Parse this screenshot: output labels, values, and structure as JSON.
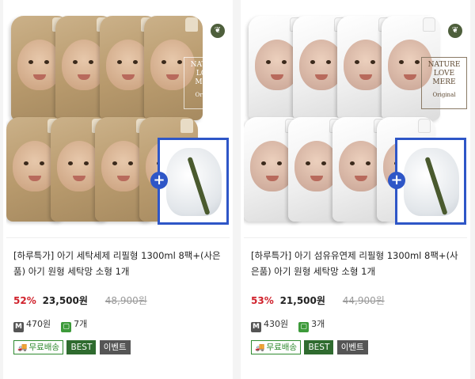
{
  "products": [
    {
      "variant": "kraft",
      "brand_lines": [
        "NATURE",
        "LOVE",
        "MERE"
      ],
      "brand_sub": "Original",
      "title": "[하루특가] 아기 세탁세제 리필형 1300ml 8팩+(사은품) 아기 원형 세탁망 소형 1개",
      "discount_rate": "52%",
      "sale_price": "23,500원",
      "original_price": "48,900원",
      "points_badge": "M",
      "points": "470원",
      "reviews_badge": "▢",
      "reviews": "7개",
      "tags": {
        "shipping": "무료배송",
        "best": "BEST",
        "event": "이벤트"
      }
    },
    {
      "variant": "white",
      "brand_lines": [
        "NATURE",
        "LOVE",
        "MERE"
      ],
      "brand_sub": "Original",
      "title": "[하루특가] 아기 섬유유연제 리필형 1300ml 8팩+(사은품) 아기 원형 세탁망 소형 1개",
      "discount_rate": "53%",
      "sale_price": "21,500원",
      "original_price": "44,900원",
      "points_badge": "M",
      "points": "430원",
      "reviews_badge": "▢",
      "reviews": "3개",
      "tags": {
        "shipping": "무료배송",
        "best": "BEST",
        "event": "이벤트"
      }
    }
  ],
  "icons": {
    "plus": "+",
    "truck": "🚚",
    "tree": "❦"
  },
  "colors": {
    "sale_red": "#d0222c",
    "gift_border": "#2e56c7",
    "best_green": "#2f6b2f",
    "ship_green": "#2f8a2f"
  }
}
